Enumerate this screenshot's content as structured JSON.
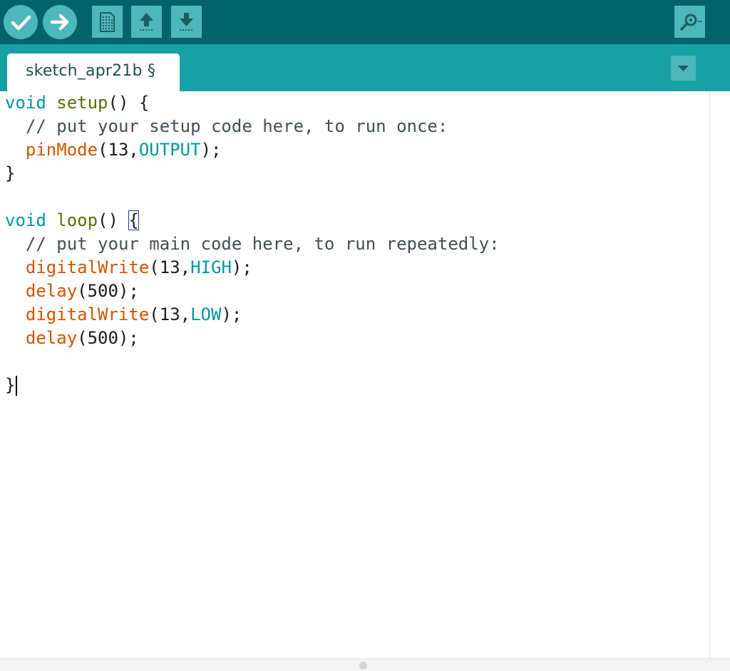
{
  "toolbar": {
    "buttons": [
      {
        "name": "verify-button",
        "icon": "checkmark-icon"
      },
      {
        "name": "upload-button",
        "icon": "arrow-right-icon"
      },
      {
        "name": "new-button",
        "icon": "new-file-icon"
      },
      {
        "name": "open-button",
        "icon": "arrow-up-icon"
      },
      {
        "name": "save-button",
        "icon": "arrow-down-icon"
      },
      {
        "name": "serial-monitor-button",
        "icon": "magnifier-icon"
      }
    ],
    "colors": {
      "background": "#006468",
      "button": "#4db7bb",
      "icon": "#ffffff"
    }
  },
  "tabs": {
    "active": {
      "label": "sketch_apr21b §"
    },
    "menu_icon": "chevron-down-icon",
    "colors": {
      "strip": "#17a1a5",
      "tab": "#ffffff"
    }
  },
  "editor": {
    "lines": [
      [
        {
          "t": "void",
          "c": "kw"
        },
        {
          "t": " ",
          "c": "plain"
        },
        {
          "t": "setup",
          "c": "name"
        },
        {
          "t": "() {",
          "c": "plain"
        }
      ],
      [
        {
          "t": "  // put your setup code here, to run once:",
          "c": "comment"
        }
      ],
      [
        {
          "t": "  ",
          "c": "plain"
        },
        {
          "t": "pinMode",
          "c": "fn"
        },
        {
          "t": "(13,",
          "c": "plain"
        },
        {
          "t": "OUTPUT",
          "c": "const"
        },
        {
          "t": ");",
          "c": "plain"
        }
      ],
      [
        {
          "t": "}",
          "c": "plain"
        }
      ],
      [],
      [
        {
          "t": "void",
          "c": "kw"
        },
        {
          "t": " ",
          "c": "plain"
        },
        {
          "t": "loop",
          "c": "name"
        },
        {
          "t": "() ",
          "c": "plain"
        },
        {
          "t": "{",
          "c": "brace-hl"
        }
      ],
      [
        {
          "t": "  // put your main code here, to run repeatedly:",
          "c": "comment"
        }
      ],
      [
        {
          "t": "  ",
          "c": "plain"
        },
        {
          "t": "digitalWrite",
          "c": "fn"
        },
        {
          "t": "(13,",
          "c": "plain"
        },
        {
          "t": "HIGH",
          "c": "const"
        },
        {
          "t": ");",
          "c": "plain"
        }
      ],
      [
        {
          "t": "  ",
          "c": "plain"
        },
        {
          "t": "delay",
          "c": "fn"
        },
        {
          "t": "(500);",
          "c": "plain"
        }
      ],
      [
        {
          "t": "  ",
          "c": "plain"
        },
        {
          "t": "digitalWrite",
          "c": "fn"
        },
        {
          "t": "(13,",
          "c": "plain"
        },
        {
          "t": "LOW",
          "c": "const"
        },
        {
          "t": ");",
          "c": "plain"
        }
      ],
      [
        {
          "t": "  ",
          "c": "plain"
        },
        {
          "t": "delay",
          "c": "fn"
        },
        {
          "t": "(500);",
          "c": "plain"
        }
      ],
      [],
      [
        {
          "t": "}",
          "c": "plain"
        },
        {
          "t": "",
          "c": "caret"
        }
      ]
    ],
    "colors": {
      "keyword": "#00979c",
      "function": "#d35400",
      "name": "#5e6d03",
      "constant": "#00979c",
      "comment": "#434f54",
      "text": "#1c1c1c"
    }
  }
}
